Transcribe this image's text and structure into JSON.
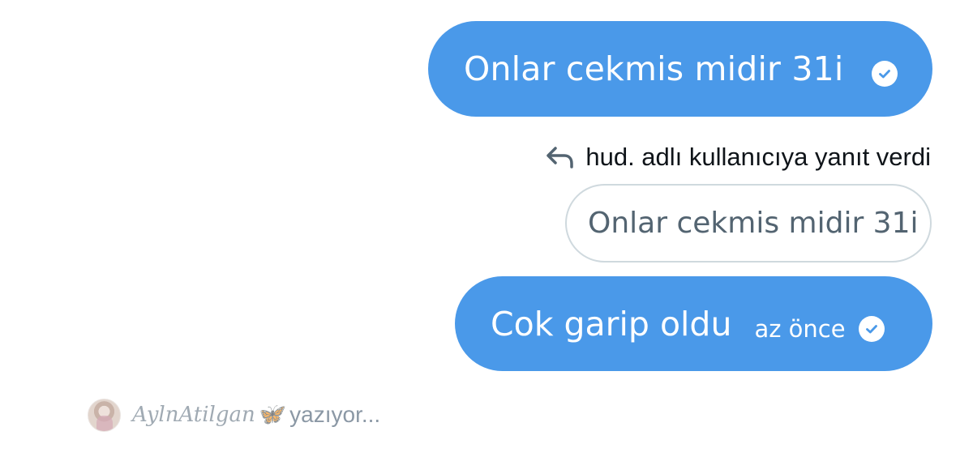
{
  "conversation": {
    "messages": [
      {
        "text": "Onlar cekmis midir 31i",
        "status": "read"
      },
      {
        "text": "Cok garip oldu",
        "time": "az önce",
        "status": "read"
      }
    ],
    "reply_context": {
      "label": "hud. adlı kullanıcıya yanıt verdi",
      "quoted_text": "Onlar cekmis midir 31i"
    },
    "typing": {
      "name": "AylnAtilgan",
      "name_suffix": "🦋",
      "label": "yazıyor..."
    }
  },
  "colors": {
    "sent_bubble": "#4a99e9",
    "check": "#4a99e9",
    "quoted_border": "#cfd9de",
    "quoted_text": "#536471",
    "typing_text": "#8b98a5"
  },
  "icons": {
    "read_receipt": "check-circle-icon",
    "reply": "reply-arrow-icon"
  }
}
